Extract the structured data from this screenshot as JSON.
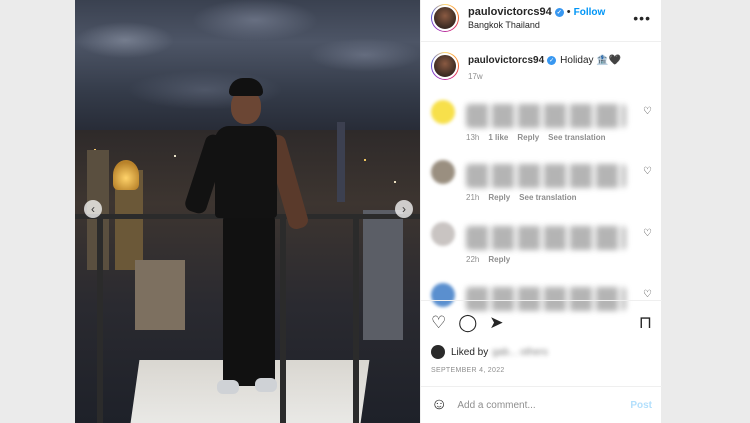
{
  "post": {
    "username": "paulovictorcs94",
    "follow_label": "Follow",
    "location": "Bangkok Thailand",
    "more_icon": "•••",
    "caption": "Holiday 🏦🖤",
    "caption_age": "17w"
  },
  "comments": [
    {
      "avatar_color": "#f7e04b",
      "meta": [
        "13h",
        "1 like",
        "Reply",
        "See translation"
      ]
    },
    {
      "avatar_color": "#9a8f80",
      "meta": [
        "21h",
        "Reply",
        "See translation"
      ]
    },
    {
      "avatar_color": "#c9c4c2",
      "meta": [
        "22h",
        "Reply"
      ]
    },
    {
      "avatar_color": "#5a8fcf",
      "meta": []
    }
  ],
  "actions": {
    "liked_by_prefix": "Liked by",
    "liked_by_blurred": "gab... others",
    "date": "SEPTEMBER 4, 2022"
  },
  "composer": {
    "placeholder": "Add a comment...",
    "post_label": "Post"
  },
  "colors": {
    "link_blue": "#0095f6",
    "muted": "#8e8e8e",
    "verified_blue": "#3897f0"
  }
}
